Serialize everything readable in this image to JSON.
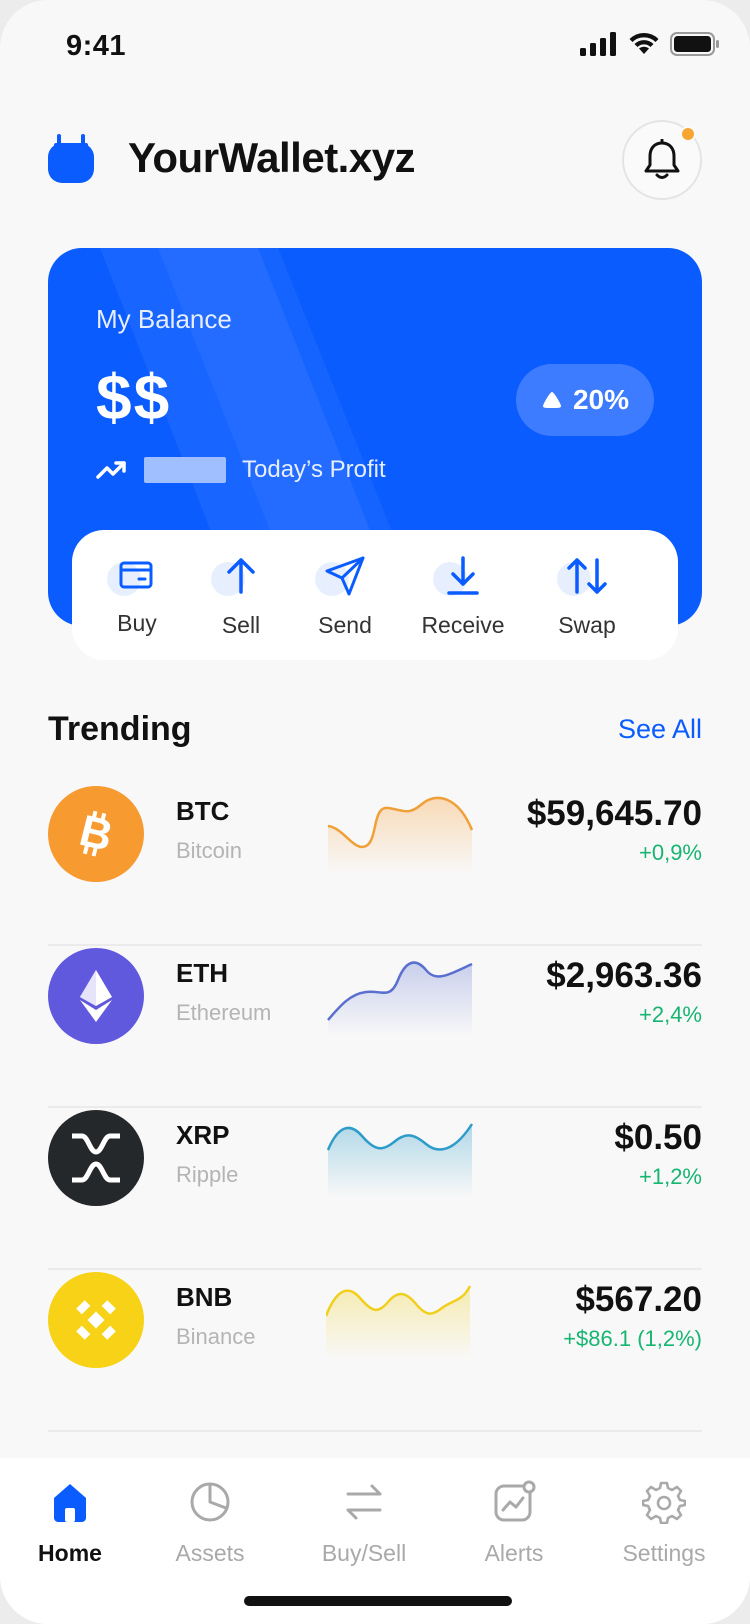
{
  "status": {
    "time": "9:41"
  },
  "header": {
    "title": "YourWallet.xyz"
  },
  "balance": {
    "label": "My Balance",
    "value": "$$",
    "change_badge": "20%",
    "profit_label": "Today’s Profit"
  },
  "actions": [
    {
      "label": "Buy",
      "icon": "wallet-icon"
    },
    {
      "label": "Sell",
      "icon": "arrow-up-icon"
    },
    {
      "label": "Send",
      "icon": "send-icon"
    },
    {
      "label": "Receive",
      "icon": "download-icon"
    },
    {
      "label": "Swap",
      "icon": "swap-icon"
    }
  ],
  "trending": {
    "title": "Trending",
    "see_all": "See All",
    "coins": [
      {
        "symbol": "BTC",
        "name": "Bitcoin",
        "price": "$59,645.70",
        "change": "+0,9%",
        "color": "#f79a2f",
        "spark_color": "#f0a039"
      },
      {
        "symbol": "ETH",
        "name": "Ethereum",
        "price": "$2,963.36",
        "change": "+2,4%",
        "color": "#6159dd",
        "spark_color": "#5b6fcf"
      },
      {
        "symbol": "XRP",
        "name": "Ripple",
        "price": "$0.50",
        "change": "+1,2%",
        "color": "#25282b",
        "spark_color": "#2d9cc9"
      },
      {
        "symbol": "BNB",
        "name": "Binance",
        "price": "$567.20",
        "change": "+$86.1 (1,2%)",
        "color": "#f7d216",
        "spark_color": "#f0cf1e"
      }
    ]
  },
  "tabs": [
    {
      "label": "Home",
      "icon": "home-icon",
      "active": true
    },
    {
      "label": "Assets",
      "icon": "pie-chart-icon",
      "active": false
    },
    {
      "label": "Buy/Sell",
      "icon": "transfer-icon",
      "active": false
    },
    {
      "label": "Alerts",
      "icon": "chart-alert-icon",
      "active": false
    },
    {
      "label": "Settings",
      "icon": "gear-icon",
      "active": false
    }
  ],
  "colors": {
    "accent": "#0a5cff",
    "positive": "#18b572",
    "notification_dot": "#f6a531"
  }
}
